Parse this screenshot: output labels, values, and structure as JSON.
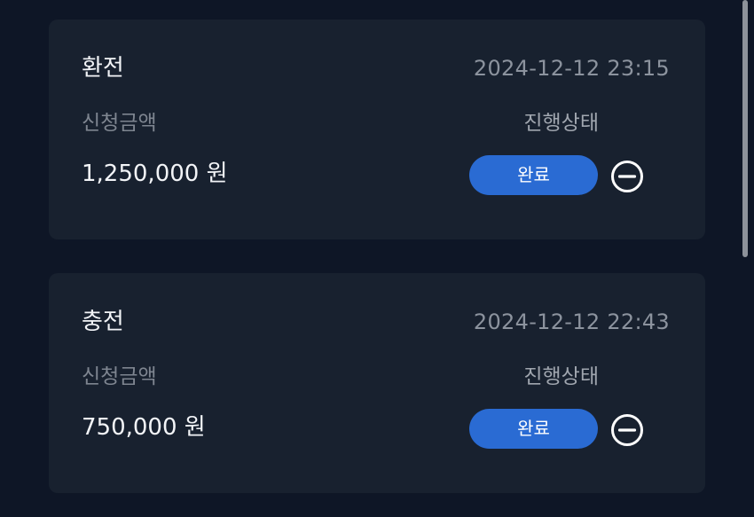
{
  "records": [
    {
      "title": "환전",
      "datetime": "2024-12-12 23:15",
      "amount_label": "신청금액",
      "amount_value": "1,250,000 원",
      "status_label": "진행상태",
      "status_value": "완료",
      "remove_icon": "minus-circle-icon"
    },
    {
      "title": "충전",
      "datetime": "2024-12-12 22:43",
      "amount_label": "신청금액",
      "amount_value": "750,000 원",
      "status_label": "진행상태",
      "status_value": "완료",
      "remove_icon": "minus-circle-icon"
    }
  ],
  "colors": {
    "background": "#0e1626",
    "card": "#18212f",
    "badge": "#2a6bd3",
    "text_primary": "#f2f4f7",
    "text_muted": "#8c939e"
  }
}
